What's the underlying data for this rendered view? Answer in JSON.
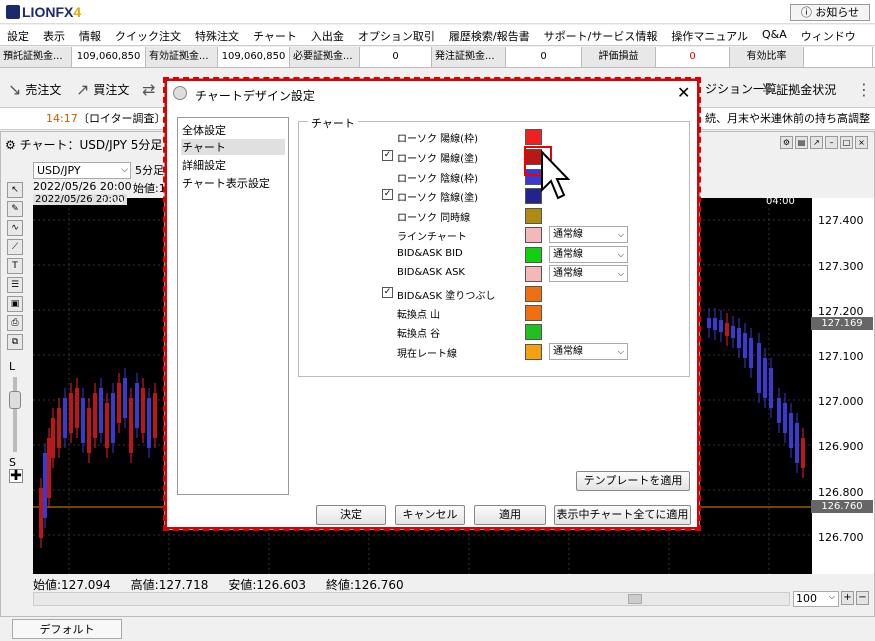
{
  "app": {
    "logo": "LIONFX",
    "logo_ver": "4",
    "notice": "お知らせ"
  },
  "menu": [
    "設定",
    "表示",
    "情報",
    "クイック注文",
    "特殊注文",
    "チャート",
    "入出金",
    "オプション取引",
    "履歴検索/報告書",
    "サポート/サービス情報",
    "操作マニュアル",
    "Q&A",
    "ウィンドウ"
  ],
  "status": [
    {
      "label": "預託証拠金...",
      "value": "109,060,850"
    },
    {
      "label": "有効証拠金...",
      "value": "109,060,850"
    },
    {
      "label": "必要証拠金...",
      "value": "0"
    },
    {
      "label": "発注証拠金...",
      "value": "0"
    },
    {
      "label": "評価損益",
      "value": "0"
    },
    {
      "label": "有効比率",
      "value": ""
    }
  ],
  "toolbar": {
    "sell": "売注文",
    "buy": "買注文",
    "positions": "ジション一覧",
    "margin": "証拠金状況"
  },
  "news": {
    "time": "14:17",
    "text": "〔ロイター調査〕N",
    "right": "続、月末や米連休前の持ち高調整"
  },
  "chart": {
    "title": "チャート：USD/JPY 5分足",
    "pair": "USD/JPY",
    "tf": "5分足",
    "date1": "2022/05/26 20:00",
    "start": "始値:1",
    "date2": "2022/05/26 20:00",
    "left_time": "1:00",
    "right_time": "04:00",
    "y_ticks": [
      "127.400",
      "127.300",
      "127.200",
      "127.100",
      "127.000",
      "126.900",
      "126.800",
      "126.700"
    ],
    "current_price": "127.169",
    "line_price": "126.760",
    "ohlc": {
      "open": "始値:127.094",
      "high": "高値:127.718",
      "low": "安値:126.603",
      "close": "終値:126.760"
    },
    "zoom": "100",
    "slider_top": "L",
    "slider_bottom": "S"
  },
  "bottom_tab": "デフォルト",
  "dialog": {
    "title": "チャートデザイン設定",
    "categories": [
      "全体設定",
      "チャート",
      "詳細設定",
      "チャート表示設定"
    ],
    "selected_category": "チャート",
    "group_label": "チャート",
    "rows": [
      {
        "label": "ローソク 陽線(枠)",
        "checkbox": false,
        "color": "#ee2020",
        "select": ""
      },
      {
        "label": "ローソク 陽線(塗)",
        "checkbox": true,
        "color": "#b81818",
        "select": ""
      },
      {
        "label": "ローソク 陰線(枠)",
        "checkbox": false,
        "color": "#3a3acc",
        "select": ""
      },
      {
        "label": "ローソク 陰線(塗)",
        "checkbox": true,
        "color": "#23238c",
        "select": ""
      },
      {
        "label": "ローソク 同時線",
        "checkbox": false,
        "color": "#b08a10",
        "select": ""
      },
      {
        "label": "ラインチャート",
        "checkbox": false,
        "color": "#f5b8b8",
        "select": "通常線"
      },
      {
        "label": "BID&ASK BID",
        "checkbox": false,
        "color": "#10d010",
        "select": "通常線"
      },
      {
        "label": "BID&ASK ASK",
        "checkbox": false,
        "color": "#f5b8b8",
        "select": "通常線"
      },
      {
        "label": "BID&ASK 塗りつぶし",
        "checkbox": true,
        "color": "#f07010",
        "select": ""
      },
      {
        "label": "転換点 山",
        "checkbox": false,
        "color": "#f07010",
        "select": ""
      },
      {
        "label": "転換点 谷",
        "checkbox": false,
        "color": "#20c020",
        "select": ""
      },
      {
        "label": "現在レート線",
        "checkbox": false,
        "color": "#f5a010",
        "select": "通常線"
      }
    ],
    "template_btn": "テンプレートを適用",
    "ok": "決定",
    "cancel": "キャンセル",
    "apply": "適用",
    "apply_all": "表示中チャート全てに適用"
  }
}
